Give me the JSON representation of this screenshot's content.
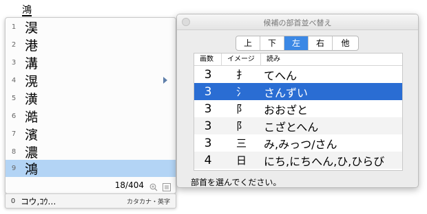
{
  "composing_text": "鴻",
  "candidates": [
    {
      "num": "1",
      "text": "淏"
    },
    {
      "num": "2",
      "text": "港"
    },
    {
      "num": "3",
      "text": "溝"
    },
    {
      "num": "4",
      "text": "滉"
    },
    {
      "num": "5",
      "text": "潢"
    },
    {
      "num": "6",
      "text": "澔"
    },
    {
      "num": "7",
      "text": "濱"
    },
    {
      "num": "8",
      "text": "濃"
    },
    {
      "num": "9",
      "text": "鴻"
    }
  ],
  "selected_candidate": "9",
  "page_count": "18/404",
  "conversion": {
    "num": "0",
    "text": "コウ,ｺｳ…",
    "mode": "カタカナ・英字"
  },
  "window": {
    "title": "候補の部首並べ替え",
    "tabs": [
      "上",
      "下",
      "左",
      "右",
      "他"
    ],
    "active_tab": "左",
    "columns": [
      "画数",
      "イメージ",
      "読み"
    ],
    "rows": [
      {
        "strokes": "3",
        "image": "扌",
        "reading": "てへん"
      },
      {
        "strokes": "3",
        "image": "氵",
        "reading": "さんずい"
      },
      {
        "strokes": "3",
        "image": "阝",
        "reading": "おおざと"
      },
      {
        "strokes": "3",
        "image": "阝",
        "reading": "こざとへん"
      },
      {
        "strokes": "3",
        "image": "三",
        "reading": "み,みっつ/さん"
      },
      {
        "strokes": "4",
        "image": "日",
        "reading": "にち,にちへん,ひ,ひらび"
      }
    ],
    "selected_row": 1,
    "status": "部首を選んでください。"
  },
  "colors": {
    "selection_blue": "#2a6dd3",
    "candidate_highlight": "#b3d4f5",
    "tab_active": "#3b88e5"
  }
}
